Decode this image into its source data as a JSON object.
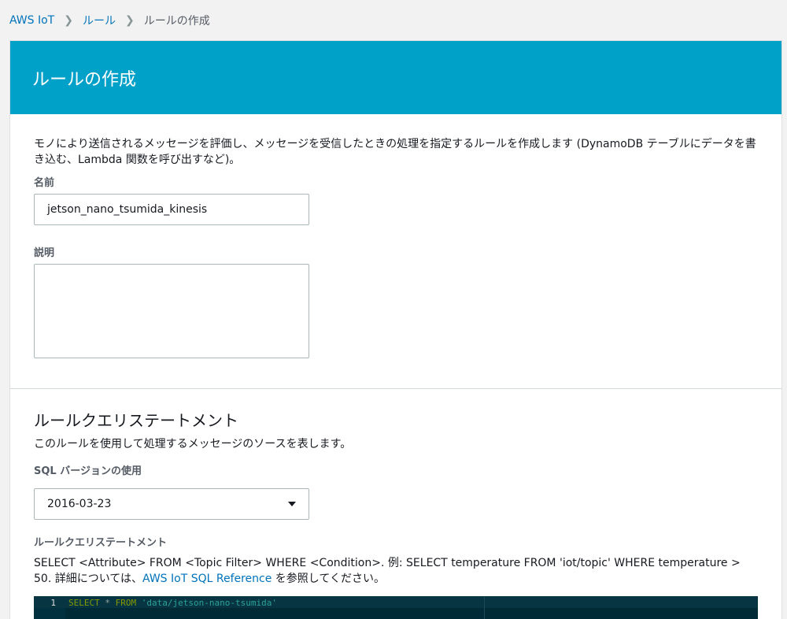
{
  "breadcrumb": {
    "items": [
      "AWS IoT",
      "ルール",
      "ルールの作成"
    ]
  },
  "page": {
    "title": "ルールの作成",
    "description": "モノにより送信されるメッセージを評価し、メッセージを受信したときの処理を指定するルールを作成します (DynamoDB テーブルにデータを書き込む、Lambda 関数を呼び出すなど)。"
  },
  "form": {
    "name_label": "名前",
    "name_value": "jetson_nano_tsumida_kinesis",
    "description_label": "説明",
    "description_value": ""
  },
  "query_section": {
    "title": "ルールクエリステートメント",
    "subtitle": "このルールを使用して処理するメッセージのソースを表します。",
    "sql_version_label": "SQL バージョンの使用",
    "sql_version_value": "2016-03-23",
    "statement_label": "ルールクエリステートメント",
    "help_text_1": "SELECT <Attribute> FROM <Topic Filter> WHERE <Condition>. 例: SELECT temperature FROM 'iot/topic' WHERE temperature > 50. 詳細については、",
    "help_link": "AWS IoT SQL Reference",
    "help_text_2": " を参照してください。"
  },
  "editor": {
    "line_number": "1",
    "tokens": {
      "select": "SELECT",
      "star": " * ",
      "from": "FROM",
      "space": " ",
      "topic": "'data/jetson-nano-tsumida'"
    }
  },
  "colors": {
    "header_bg": "#00a1c9",
    "link": "#0073bb",
    "editor_bg": "#002b36"
  }
}
